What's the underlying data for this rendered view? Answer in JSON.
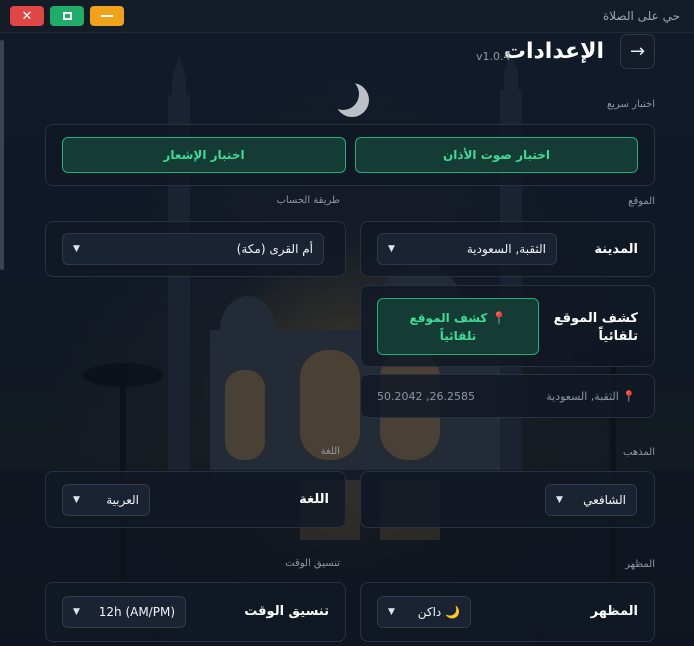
{
  "window": {
    "title": "حي على الصلاة",
    "close_glyph": "✕",
    "maximize_glyph": "",
    "minimize_glyph": ""
  },
  "header": {
    "title": "الإعدادات",
    "version": "v1.0.4",
    "back_icon": "→"
  },
  "quick_test": {
    "label": "اختبار سريع",
    "adhan_button": "اختبار صوت الأذان",
    "notification_button": "اختبار الإشعار"
  },
  "location": {
    "section_label": "الموقع",
    "city_label": "المدينة",
    "city_value": "الثقبة, السعودية",
    "auto_detect_label": "كشف الموقع تلقائياً",
    "auto_detect_button": "📍 كشف الموقع تلقائياً",
    "detected_place": "📍 الثقبة, السعودية",
    "coordinates": "26.2585, 50.2042"
  },
  "calc_method": {
    "section_label": "طريقة الحساب",
    "value": "أم القرى (مكة)"
  },
  "madhab": {
    "section_label": "المذهب",
    "value": "الشافعي"
  },
  "language": {
    "section_label": "اللغة",
    "field_label": "اللغة",
    "value": "العربية"
  },
  "appearance": {
    "section_label": "المظهر",
    "field_label": "المظهر",
    "value": "🌙 داكن"
  },
  "time_format": {
    "section_label": "تنسيق الوقت",
    "field_label": "تنسيق الوقت",
    "value": "12h (AM/PM)"
  },
  "colors": {
    "accent_green": "#3ddc97",
    "close_red": "#e04646",
    "max_green": "#1fae6a",
    "min_orange": "#f0a21a"
  }
}
